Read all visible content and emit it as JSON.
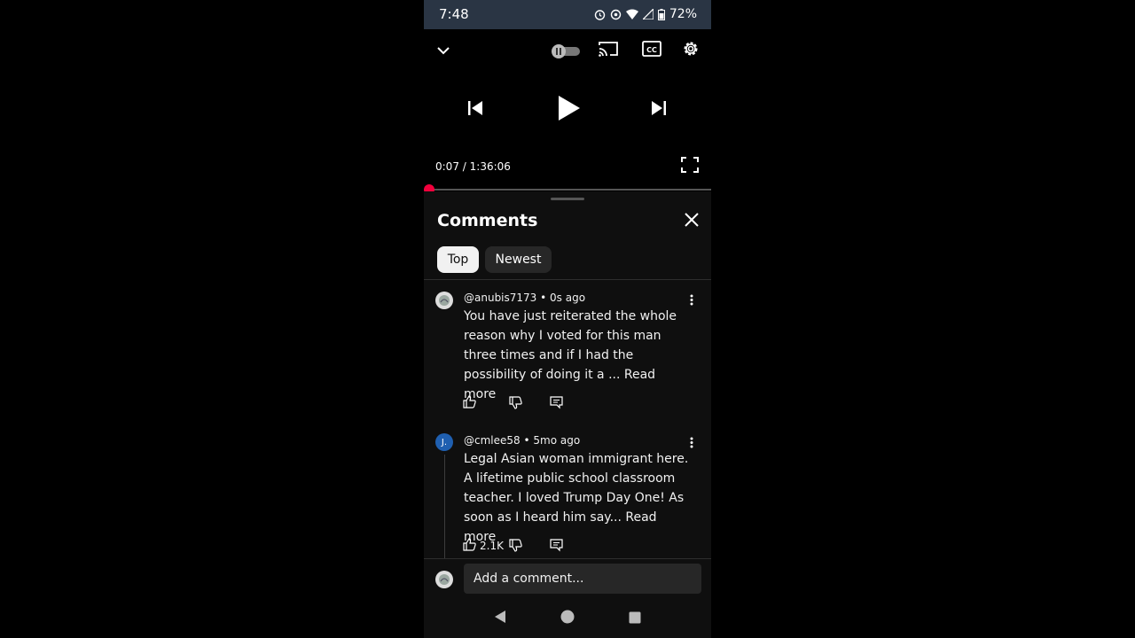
{
  "status_bar": {
    "time": "7:48",
    "battery": "72%"
  },
  "player": {
    "elapsed": "0:07",
    "separator": "/",
    "duration": "1:36:06",
    "progress_fraction": 0.0012,
    "icons": [
      "chevron-down-icon",
      "autoplay-toggle",
      "cast-icon",
      "captions-icon",
      "gear-icon",
      "previous-icon",
      "play-icon",
      "next-icon",
      "fullscreen-icon"
    ]
  },
  "comments": {
    "title": "Comments",
    "sort_tabs": [
      {
        "label": "Top",
        "selected": true
      },
      {
        "label": "Newest",
        "selected": false
      }
    ],
    "items": [
      {
        "author": "@anubis7173",
        "sep": "•",
        "age": "0s ago",
        "avatar_letter": "",
        "lines": [
          "You have just reiterated the whole",
          "reason why I voted for this man",
          "three times and if I had the"
        ],
        "last_line": "possibility of doing it a ... ",
        "read_more": "Read more",
        "likes": ""
      },
      {
        "author": "@cmlee58",
        "sep": "•",
        "age": "5mo ago",
        "avatar_letter": "J.",
        "lines": [
          "Legal Asian woman immigrant here.",
          "A lifetime public school classroom",
          "teacher. I loved Trump Day One! As"
        ],
        "last_line": "soon as I heard him say... ",
        "read_more": "Read more",
        "likes": "2.1K"
      }
    ],
    "add_placeholder": "Add a comment..."
  },
  "colors": {
    "accent_red": "#f2003c",
    "panel_bg": "#0f0f0f",
    "status_bar_bg": "#2a3544",
    "avatar_blue": "#1f5fb0"
  }
}
